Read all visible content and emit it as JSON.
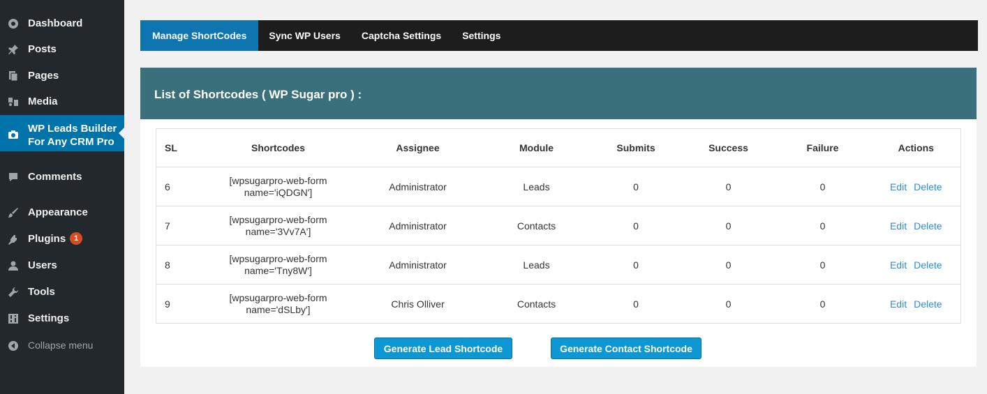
{
  "sidebar": {
    "items": [
      {
        "label": "Dashboard",
        "icon": "dashboard-icon"
      },
      {
        "label": "Posts",
        "icon": "pin-icon"
      },
      {
        "label": "Pages",
        "icon": "pages-icon"
      },
      {
        "label": "Media",
        "icon": "media-icon"
      },
      {
        "label": "WP Leads Builder For Any CRM Pro",
        "icon": "leads-builder-icon"
      },
      {
        "label": "Comments",
        "icon": "comment-icon"
      },
      {
        "label": "Appearance",
        "icon": "brush-icon"
      },
      {
        "label": "Plugins",
        "icon": "plugin-icon",
        "badge": "1"
      },
      {
        "label": "Users",
        "icon": "user-icon"
      },
      {
        "label": "Tools",
        "icon": "wrench-icon"
      },
      {
        "label": "Settings",
        "icon": "settings-icon"
      },
      {
        "label": "Collapse menu",
        "icon": "collapse-icon"
      }
    ],
    "active_color": "#0073aa",
    "badge_color": "#d54e21"
  },
  "tabs": [
    {
      "label": "Manage ShortCodes",
      "active": true
    },
    {
      "label": "Sync WP Users"
    },
    {
      "label": "Captcha Settings"
    },
    {
      "label": "Settings"
    }
  ],
  "panel": {
    "title": "List of Shortcodes ( WP Sugar pro ) :",
    "header_color": "#3a6f7c"
  },
  "table": {
    "columns": [
      "SL",
      "Shortcodes",
      "Assignee",
      "Module",
      "Submits",
      "Success",
      "Failure",
      "Actions"
    ],
    "rows": [
      {
        "sl": "6",
        "shortcode_line1": "[wpsugarpro-web-form",
        "shortcode_line2": "name='iQDGN']",
        "assignee": "Administrator",
        "module": "Leads",
        "submits": "0",
        "success": "0",
        "failure": "0",
        "edit": "Edit",
        "delete": "Delete"
      },
      {
        "sl": "7",
        "shortcode_line1": "[wpsugarpro-web-form",
        "shortcode_line2": "name='3Vv7A']",
        "assignee": "Administrator",
        "module": "Contacts",
        "submits": "0",
        "success": "0",
        "failure": "0",
        "edit": "Edit",
        "delete": "Delete"
      },
      {
        "sl": "8",
        "shortcode_line1": "[wpsugarpro-web-form",
        "shortcode_line2": "name='Tny8W']",
        "assignee": "Administrator",
        "module": "Leads",
        "submits": "0",
        "success": "0",
        "failure": "0",
        "edit": "Edit",
        "delete": "Delete"
      },
      {
        "sl": "9",
        "shortcode_line1": "[wpsugarpro-web-form",
        "shortcode_line2": "name='dSLby']",
        "assignee": "Chris Olliver",
        "module": "Contacts",
        "submits": "0",
        "success": "0",
        "failure": "0",
        "edit": "Edit",
        "delete": "Delete"
      }
    ]
  },
  "buttons": {
    "lead": "Generate Lead Shortcode",
    "contact": "Generate Contact Shortcode"
  }
}
